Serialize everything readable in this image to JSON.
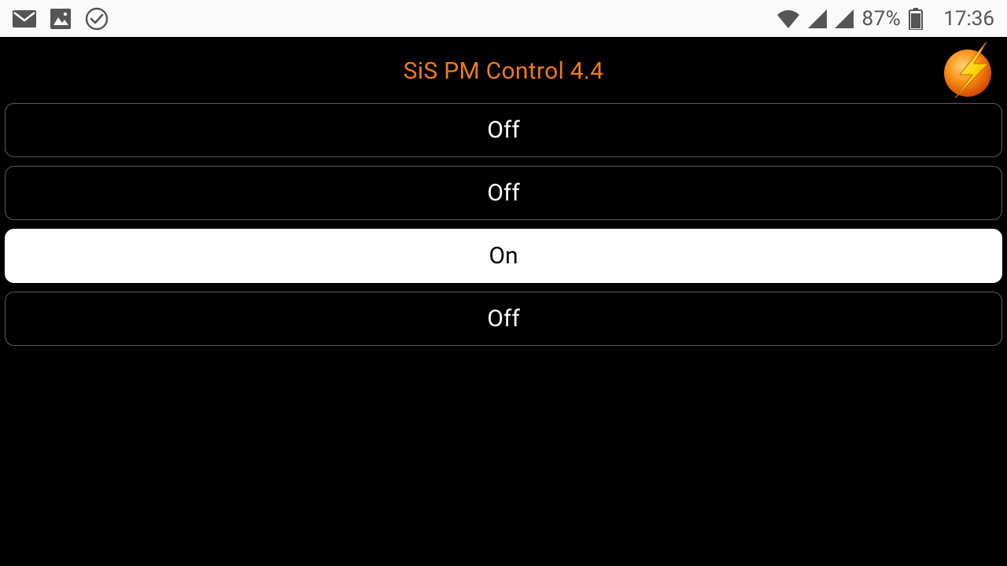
{
  "status_bar": {
    "battery_pct": "87%",
    "time": "17:36"
  },
  "app": {
    "title": "SiS PM Control 4.4"
  },
  "outlets": [
    {
      "label": "Off",
      "state": "off"
    },
    {
      "label": "Off",
      "state": "off"
    },
    {
      "label": "On",
      "state": "on"
    },
    {
      "label": "Off",
      "state": "off"
    }
  ],
  "colors": {
    "accent": "#ec7b1a"
  }
}
